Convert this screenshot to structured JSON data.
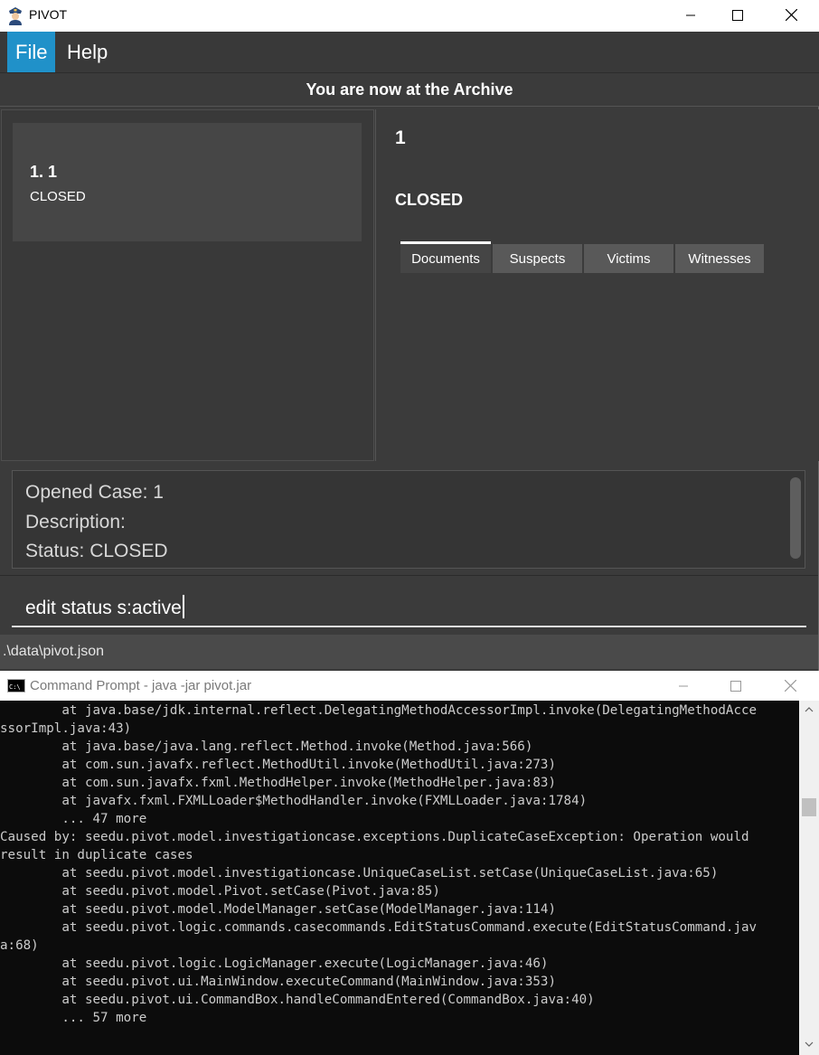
{
  "app": {
    "title": "PIVOT",
    "icon": "police-officer-icon"
  },
  "menu": {
    "items": [
      {
        "label": "File",
        "active": true
      },
      {
        "label": "Help",
        "active": false
      }
    ]
  },
  "location_banner": "You are now at the Archive",
  "case_list": [
    {
      "title": "1.  1",
      "status": "CLOSED"
    }
  ],
  "case_detail": {
    "title": "1",
    "status": "CLOSED",
    "tabs": [
      "Documents",
      "Suspects",
      "Victims",
      "Witnesses"
    ],
    "selected_tab": "Documents"
  },
  "result_display": {
    "lines": [
      "Opened Case: 1",
      "Description:",
      "Status: CLOSED"
    ]
  },
  "command_box": {
    "value": "edit status s:active"
  },
  "status_bar": {
    "path": ".\\data\\pivot.json"
  },
  "console": {
    "title": "Command Prompt - java  -jar pivot.jar",
    "lines": [
      "        at java.base/jdk.internal.reflect.DelegatingMethodAccessorImpl.invoke(DelegatingMethodAcce",
      "ssorImpl.java:43)",
      "        at java.base/java.lang.reflect.Method.invoke(Method.java:566)",
      "        at com.sun.javafx.reflect.MethodUtil.invoke(MethodUtil.java:273)",
      "        at com.sun.javafx.fxml.MethodHelper.invoke(MethodHelper.java:83)",
      "        at javafx.fxml.FXMLLoader$MethodHandler.invoke(FXMLLoader.java:1784)",
      "        ... 47 more",
      "Caused by: seedu.pivot.model.investigationcase.exceptions.DuplicateCaseException: Operation would",
      "result in duplicate cases",
      "        at seedu.pivot.model.investigationcase.UniqueCaseList.setCase(UniqueCaseList.java:65)",
      "        at seedu.pivot.model.Pivot.setCase(Pivot.java:85)",
      "        at seedu.pivot.model.ModelManager.setCase(ModelManager.java:114)",
      "        at seedu.pivot.logic.commands.casecommands.EditStatusCommand.execute(EditStatusCommand.jav",
      "a:68)",
      "        at seedu.pivot.logic.LogicManager.execute(LogicManager.java:46)",
      "        at seedu.pivot.ui.MainWindow.executeCommand(MainWindow.java:353)",
      "        at seedu.pivot.ui.CommandBox.handleCommandEntered(CommandBox.java:40)",
      "        ... 57 more"
    ]
  },
  "colors": {
    "accent": "#2091c9",
    "background": "#3b3b3b",
    "console_bg": "#0c0c0c"
  }
}
